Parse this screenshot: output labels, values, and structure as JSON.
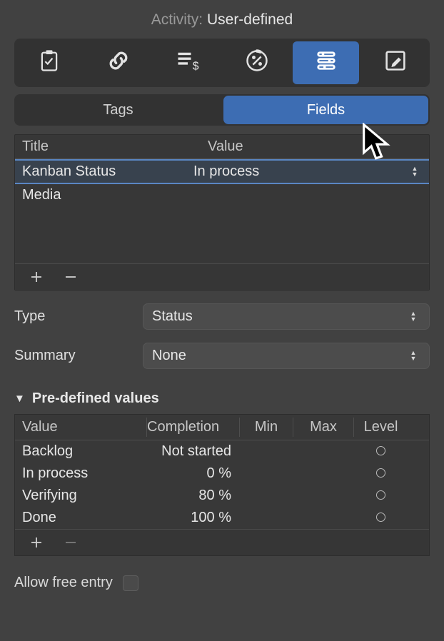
{
  "activity": {
    "label": "Activity:",
    "value": "User-defined"
  },
  "toolbar": {
    "items": [
      {
        "name": "checklist-icon",
        "active": false
      },
      {
        "name": "link-icon",
        "active": false
      },
      {
        "name": "cost-icon",
        "active": false
      },
      {
        "name": "percent-icon",
        "active": false
      },
      {
        "name": "fields-list-icon",
        "active": true
      },
      {
        "name": "edit-icon",
        "active": false
      }
    ]
  },
  "segmented": {
    "tags_label": "Tags",
    "fields_label": "Fields",
    "active": "fields"
  },
  "fields_table": {
    "header_title": "Title",
    "header_value": "Value",
    "rows": [
      {
        "title": "Kanban Status",
        "value": "In process",
        "selected": true
      },
      {
        "title": "Media",
        "value": "",
        "selected": false
      }
    ]
  },
  "form": {
    "type_label": "Type",
    "type_value": "Status",
    "summary_label": "Summary",
    "summary_value": "None"
  },
  "predef": {
    "section_title": "Pre-defined values",
    "header_value": "Value",
    "header_completion": "Completion",
    "header_min": "Min",
    "header_max": "Max",
    "header_level": "Level",
    "rows": [
      {
        "value": "Backlog",
        "completion": "Not started",
        "min": "",
        "max": "",
        "level": false
      },
      {
        "value": "In process",
        "completion": "0 %",
        "min": "",
        "max": "",
        "level": false
      },
      {
        "value": "Verifying",
        "completion": "80 %",
        "min": "",
        "max": "",
        "level": false
      },
      {
        "value": "Done",
        "completion": "100 %",
        "min": "",
        "max": "",
        "level": false
      }
    ]
  },
  "allow_free_entry": {
    "label": "Allow free entry",
    "checked": false
  }
}
